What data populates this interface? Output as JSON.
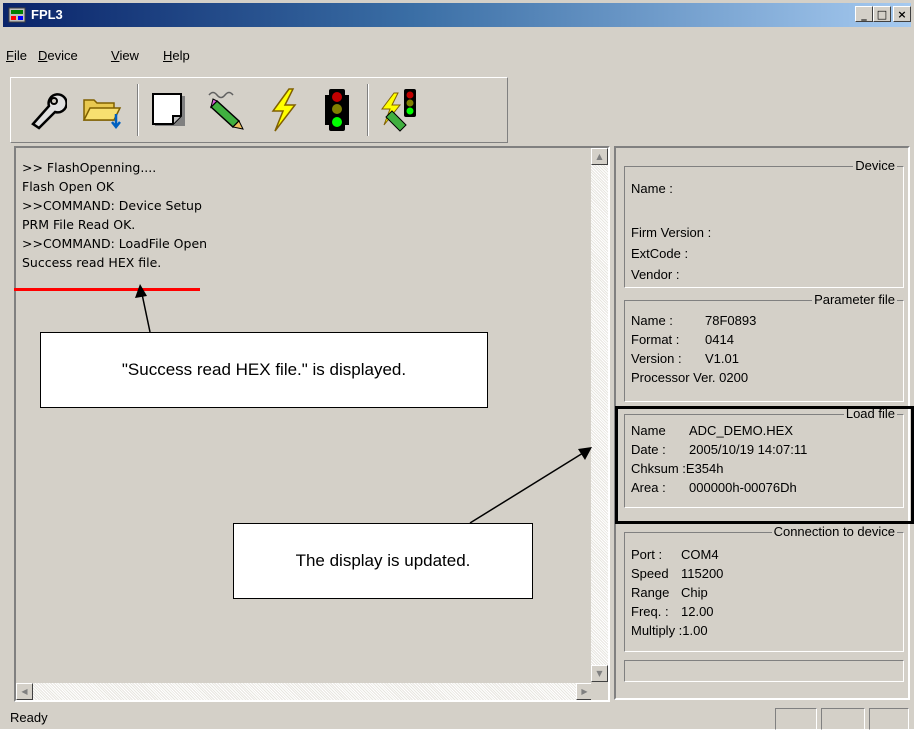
{
  "window": {
    "title": "FPL3",
    "controls": {
      "minimize": "_",
      "maximize": "□",
      "close": "×"
    }
  },
  "menu": [
    {
      "key": "F",
      "rest": "ile"
    },
    {
      "key": "D",
      "rest": "evice"
    },
    {
      "key": "V",
      "rest": "iew"
    },
    {
      "key": "H",
      "rest": "elp"
    }
  ],
  "toolbar": {
    "icons": [
      "wrench-icon",
      "folder-open-icon",
      "blank-page-icon",
      "program-pen-icon",
      "lightning-icon",
      "traffic-light-icon",
      "lightning-traffic-icon"
    ]
  },
  "log": {
    "lines": [
      ">> FlashOpenning....",
      "Flash Open OK",
      ">>COMMAND: Device Setup",
      "PRM File Read OK.",
      ">>COMMAND: LoadFile Open",
      "Success read HEX file."
    ]
  },
  "device": {
    "title": "Device",
    "name_label": "Name :",
    "firm_label": "Firm Version :",
    "extcode_label": "ExtCode :",
    "vendor_label": "Vendor :"
  },
  "parameter_file": {
    "title": "Parameter file",
    "name_label": "Name :",
    "name_value": "78F0893",
    "format_label": "Format :",
    "format_value": "0414",
    "version_label": "Version :",
    "version_value": "V1.01",
    "processor": "Processor Ver. 0200"
  },
  "load_file": {
    "title": "Load file",
    "name_label": "Name",
    "name_value": "ADC_DEMO.HEX",
    "date_label": "Date :",
    "date_value": "2005/10/19 14:07:11",
    "chksum_label": "Chksum :",
    "chksum_value": "E354h",
    "area_label": "Area :",
    "area_value": "000000h-00076Dh"
  },
  "connection": {
    "title": "Connection to device",
    "port_label": "Port :",
    "port_value": "COM4",
    "speed_label": "Speed",
    "speed_value": "115200",
    "range_label": "Range",
    "range_value": "Chip",
    "freq_label": "Freq. :",
    "freq_value": "12.00",
    "multiply_label": "Multiply :",
    "multiply_value": "1.00"
  },
  "status": {
    "text": "Ready"
  },
  "annotations": {
    "callout1": "\"Success read HEX file.\" is displayed.",
    "callout2": "The display is updated."
  },
  "colors": {
    "titlebar_start": "#0a246a",
    "titlebar_end": "#a6caf0",
    "face": "#d4d0c8",
    "underline": "#ff0000"
  }
}
